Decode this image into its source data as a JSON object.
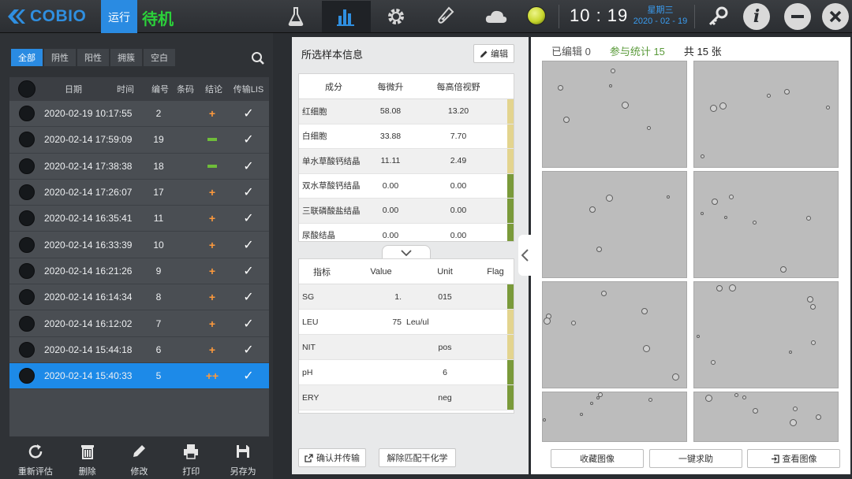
{
  "header": {
    "brand": "COBIO",
    "run_tab": "运行",
    "status": "待机",
    "nav_icons": [
      "flask-icon",
      "bar-chart-icon",
      "gear-icon",
      "test-tube-icon",
      "cloud-icon"
    ],
    "status_light_color": "#c7d62c",
    "time": "10 : 19",
    "weekday": "星期三",
    "date": "2020 - 02 - 19"
  },
  "filters": [
    "全部",
    "阴性",
    "阳性",
    "拥簇",
    "空白"
  ],
  "list": {
    "columns": [
      "日期",
      "时间",
      "编号",
      "条码",
      "结论",
      "传输LIS"
    ],
    "rows": [
      {
        "datetime": "2020-02-19 10:17:55",
        "no": "2",
        "result": "+"
      },
      {
        "datetime": "2020-02-14 17:59:09",
        "no": "19",
        "result": "-"
      },
      {
        "datetime": "2020-02-14 17:38:38",
        "no": "18",
        "result": "-"
      },
      {
        "datetime": "2020-02-14 17:26:07",
        "no": "17",
        "result": "+"
      },
      {
        "datetime": "2020-02-14 16:35:41",
        "no": "11",
        "result": "+"
      },
      {
        "datetime": "2020-02-14 16:33:39",
        "no": "10",
        "result": "+"
      },
      {
        "datetime": "2020-02-14 16:21:26",
        "no": "9",
        "result": "+"
      },
      {
        "datetime": "2020-02-14 16:14:34",
        "no": "8",
        "result": "+"
      },
      {
        "datetime": "2020-02-14 16:12:02",
        "no": "7",
        "result": "+"
      },
      {
        "datetime": "2020-02-14 15:44:18",
        "no": "6",
        "result": "+"
      },
      {
        "datetime": "2020-02-14 15:40:33",
        "no": "5",
        "result": "++"
      }
    ],
    "lis_mark": "✓"
  },
  "toolbar": [
    "重新评估",
    "删除",
    "修改",
    "打印",
    "另存为"
  ],
  "sample_info": {
    "title": "所选样本信息",
    "edit": "编辑",
    "columns": [
      "成分",
      "每微升",
      "每高倍视野"
    ],
    "rows": [
      {
        "name": "红细胞",
        "per_ul": "58.08",
        "per_hpf": "13.20",
        "flag_color": "#e3d48e"
      },
      {
        "name": "白细胞",
        "per_ul": "33.88",
        "per_hpf": "7.70",
        "flag_color": "#e3d48e"
      },
      {
        "name": "单水草酸钙结晶",
        "per_ul": "11.11",
        "per_hpf": "2.49",
        "flag_color": "#e3d48e"
      },
      {
        "name": "双水草酸钙结晶",
        "per_ul": "0.00",
        "per_hpf": "0.00",
        "flag_color": "#7a9a3a"
      },
      {
        "name": "三联磷酸盐结晶",
        "per_ul": "0.00",
        "per_hpf": "0.00",
        "flag_color": "#7a9a3a"
      },
      {
        "name": "尿酸结晶",
        "per_ul": "0.00",
        "per_hpf": "0.00",
        "flag_color": "#7a9a3a"
      }
    ]
  },
  "chem": {
    "columns": [
      "指标",
      "Value",
      "Unit",
      "Flag"
    ],
    "rows": [
      {
        "name": "SG",
        "value": "1.",
        "unit": "015",
        "flag_color": "#7a9a3a"
      },
      {
        "name": "LEU",
        "value": "75",
        "unit": "Leu/ul",
        "flag_color": "#e3d48e"
      },
      {
        "name": "NIT",
        "value": "",
        "unit": "pos",
        "flag_color": "#e3d48e"
      },
      {
        "name": "pH",
        "value": "",
        "unit": "6",
        "flag_color": "#7a9a3a"
      },
      {
        "name": "ERY",
        "value": "",
        "unit": "neg",
        "flag_color": "#7a9a3a"
      }
    ]
  },
  "mid_buttons": {
    "confirm": "确认并传输",
    "unmatch": "解除匹配干化学"
  },
  "images": {
    "edited": "已编辑 0",
    "counted": "参与统计 15",
    "total": "共 15 张",
    "buttons": [
      "收藏图像",
      "一键求助",
      "查看图像"
    ]
  }
}
